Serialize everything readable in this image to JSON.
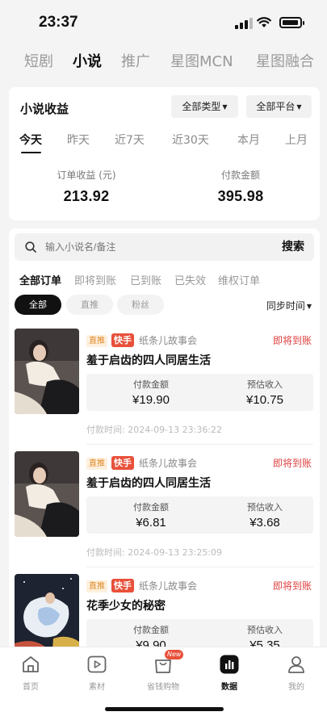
{
  "status_bar": {
    "time": "23:37"
  },
  "top_tabs": [
    {
      "label": "短剧",
      "active": false
    },
    {
      "label": "小说",
      "active": true
    },
    {
      "label": "推广",
      "active": false
    },
    {
      "label": "星图MCN",
      "active": false
    },
    {
      "label": "星图融合",
      "active": false
    }
  ],
  "income": {
    "title": "小说收益",
    "type_filter": "全部类型",
    "platform_filter": "全部平台",
    "periods": [
      "今天",
      "昨天",
      "近7天",
      "近30天",
      "本月",
      "上月"
    ],
    "active_period": "今天",
    "order_income_label": "订单收益 (元)",
    "order_income_value": "213.92",
    "paid_amount_label": "付款金额",
    "paid_amount_value": "395.98"
  },
  "orders": {
    "search_placeholder": "输入小说名/备注",
    "search_button": "搜索",
    "status_tabs": [
      "全部订单",
      "即将到账",
      "已到账",
      "已失效",
      "维权订单"
    ],
    "active_status_tab": "全部订单",
    "chips": [
      "全部",
      "直推",
      "粉丝"
    ],
    "active_chip": "全部",
    "sort_label": "同步时间",
    "items": [
      {
        "badge_type": "直推",
        "platform": "快手",
        "account": "纸条儿故事会",
        "status": "即将到账",
        "title": "羞于启齿的四人同居生活",
        "paid_label": "付款金额",
        "paid_value": "¥19.90",
        "est_label": "预估收入",
        "est_value": "¥10.75",
        "pay_time": "付款时间: 2024-09-13 23:36:22"
      },
      {
        "badge_type": "直推",
        "platform": "快手",
        "account": "纸条儿故事会",
        "status": "即将到账",
        "title": "羞于启齿的四人同居生活",
        "paid_label": "付款金额",
        "paid_value": "¥6.81",
        "est_label": "预估收入",
        "est_value": "¥3.68",
        "pay_time": "付款时间: 2024-09-13 23:25:09"
      },
      {
        "badge_type": "直推",
        "platform": "快手",
        "account": "纸条儿故事会",
        "status": "即将到账",
        "title": "花季少女的秘密",
        "paid_label": "付款金额",
        "paid_value": "¥9.90",
        "est_label": "预估收入",
        "est_value": "¥5.35",
        "pay_time": ""
      }
    ]
  },
  "bottom_nav": [
    {
      "label": "首页",
      "icon": "home-icon",
      "active": false
    },
    {
      "label": "素材",
      "icon": "play-icon",
      "active": false
    },
    {
      "label": "省钱购物",
      "icon": "shopping-bag-icon",
      "active": false,
      "badge": "New"
    },
    {
      "label": "数据",
      "icon": "data-chart-icon",
      "active": true
    },
    {
      "label": "我的",
      "icon": "user-icon",
      "active": false
    }
  ]
}
